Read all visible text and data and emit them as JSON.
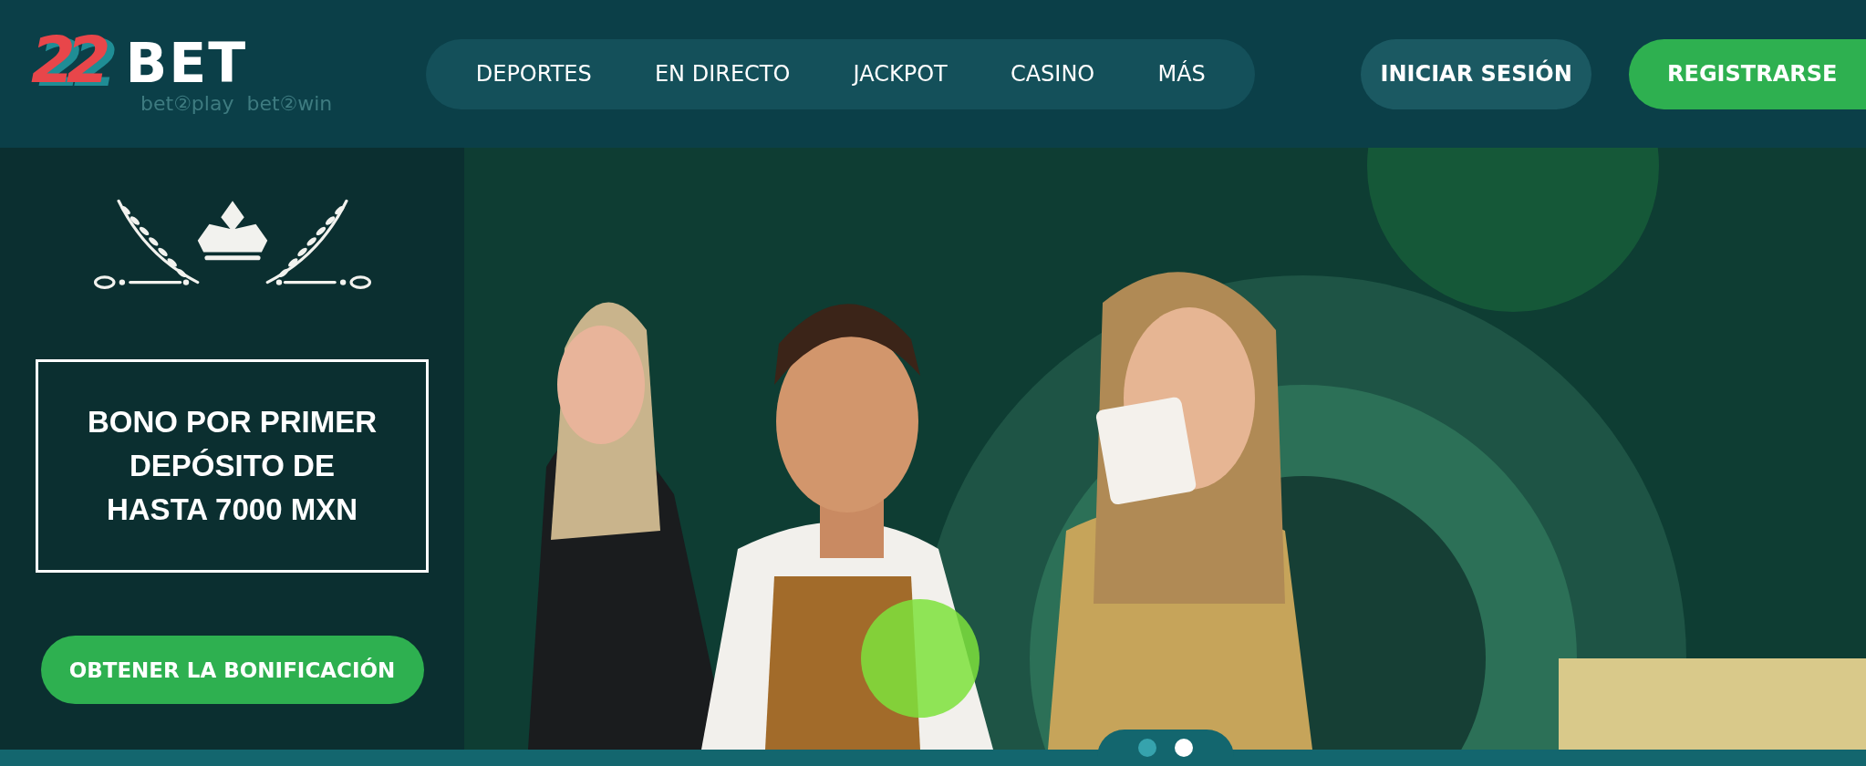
{
  "logo": {
    "number": "22",
    "word": "BET",
    "tagline": "bet②play  bet②win"
  },
  "nav": [
    {
      "label": "DEPORTES"
    },
    {
      "label": "EN DIRECTO"
    },
    {
      "label": "JACKPOT"
    },
    {
      "label": "CASINO"
    },
    {
      "label": "MÁS"
    }
  ],
  "login_button": "INICIAR SESIÓN",
  "register_button": "REGISTRARSE",
  "promo": {
    "headline": "BONO POR PRIMER DEPÓSITO DE HASTA 7000 MXN",
    "button": "OBTENER LA BONIFICACIÓN"
  },
  "carousel": [
    {
      "selected": false
    },
    {
      "selected": true
    }
  ]
}
